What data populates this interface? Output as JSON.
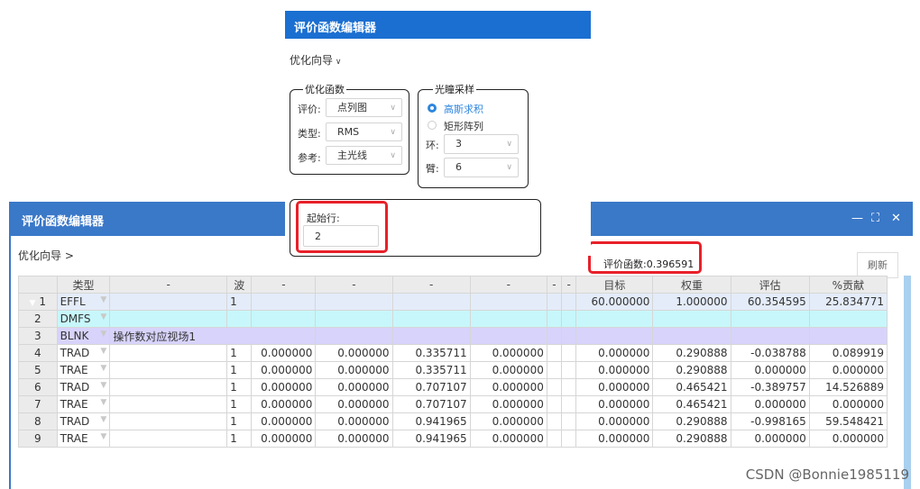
{
  "back_window": {
    "title": "评价函数编辑器",
    "controls": [
      "—",
      "⛶",
      "✕"
    ],
    "breadcrumb": "优化向导 >",
    "merit_label": "评价函数:0.396591",
    "refresh_label": "刷新",
    "columns": [
      "",
      "类型",
      "-",
      "波",
      "-",
      "-",
      "-",
      "-",
      "-",
      "-",
      "目标",
      "权重",
      "评估",
      "%贡献"
    ],
    "rows": [
      {
        "n": "1",
        "type": "EFFL",
        "text": "",
        "wave": "1",
        "c4": "",
        "c5": "",
        "c6": "",
        "c7": "",
        "target": "60.000000",
        "weight": "1.000000",
        "value": "60.354595",
        "contrib": "25.834771"
      },
      {
        "n": "2",
        "type": "DMFS",
        "text": "",
        "wave": "",
        "c4": "",
        "c5": "",
        "c6": "",
        "c7": "",
        "target": "",
        "weight": "",
        "value": "",
        "contrib": ""
      },
      {
        "n": "3",
        "type": "BLNK",
        "text": "操作数对应视场1",
        "wave": "",
        "c4": "",
        "c5": "",
        "c6": "",
        "c7": "",
        "target": "",
        "weight": "",
        "value": "",
        "contrib": ""
      },
      {
        "n": "4",
        "type": "TRAD",
        "text": "",
        "wave": "1",
        "c4": "0.000000",
        "c5": "0.000000",
        "c6": "0.335711",
        "c7": "0.000000",
        "target": "0.000000",
        "weight": "0.290888",
        "value": "-0.038788",
        "contrib": "0.089919"
      },
      {
        "n": "5",
        "type": "TRAE",
        "text": "",
        "wave": "1",
        "c4": "0.000000",
        "c5": "0.000000",
        "c6": "0.335711",
        "c7": "0.000000",
        "target": "0.000000",
        "weight": "0.290888",
        "value": "0.000000",
        "contrib": "0.000000"
      },
      {
        "n": "6",
        "type": "TRAD",
        "text": "",
        "wave": "1",
        "c4": "0.000000",
        "c5": "0.000000",
        "c6": "0.707107",
        "c7": "0.000000",
        "target": "0.000000",
        "weight": "0.465421",
        "value": "-0.389757",
        "contrib": "14.526889"
      },
      {
        "n": "7",
        "type": "TRAE",
        "text": "",
        "wave": "1",
        "c4": "0.000000",
        "c5": "0.000000",
        "c6": "0.707107",
        "c7": "0.000000",
        "target": "0.000000",
        "weight": "0.465421",
        "value": "0.000000",
        "contrib": "0.000000"
      },
      {
        "n": "8",
        "type": "TRAD",
        "text": "",
        "wave": "1",
        "c4": "0.000000",
        "c5": "0.000000",
        "c6": "0.941965",
        "c7": "0.000000",
        "target": "0.000000",
        "weight": "0.290888",
        "value": "-0.998165",
        "contrib": "59.548421"
      },
      {
        "n": "9",
        "type": "TRAE",
        "text": "",
        "wave": "1",
        "c4": "0.000000",
        "c5": "0.000000",
        "c6": "0.941965",
        "c7": "0.000000",
        "target": "0.000000",
        "weight": "0.290888",
        "value": "0.000000",
        "contrib": "0.000000"
      }
    ]
  },
  "panel": {
    "title": "评价函数编辑器",
    "breadcrumb": "优化向导",
    "opt_group": {
      "legend": "优化函数",
      "fields": [
        {
          "label": "评价:",
          "value": "点列图"
        },
        {
          "label": "类型:",
          "value": "RMS"
        },
        {
          "label": "参考:",
          "value": "主光线"
        }
      ]
    },
    "pupil_group": {
      "legend": "光瞳采样",
      "options": [
        {
          "label": "高斯求积",
          "selected": true
        },
        {
          "label": "矩形阵列",
          "selected": false
        }
      ],
      "fields": [
        {
          "label": "环:",
          "value": "3"
        },
        {
          "label": "臂:",
          "value": "6"
        }
      ]
    },
    "start_row": {
      "label": "起始行:",
      "value": "2"
    }
  },
  "watermark": "CSDN @Bonnie1985119",
  "colors": {
    "title_blue": "#1b6fd1",
    "window_blue": "#3a78c8",
    "highlight_red": "#e8202a",
    "row_cyan": "#c7f7fb",
    "row_purple": "#d7d3fb"
  }
}
